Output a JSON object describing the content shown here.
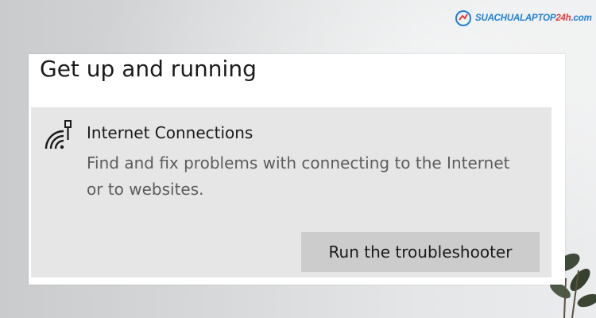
{
  "watermark": {
    "brand_main": "SUACHUALAPTOP",
    "brand_accent": "24h",
    "brand_suffix": ".com",
    "color_main": "#1e7fd6",
    "color_accent": "#e23b3b"
  },
  "panel": {
    "title": "Get up and running"
  },
  "troubleshooter": {
    "icon": "wifi-network-icon",
    "title": "Internet Connections",
    "description": "Find and fix problems with connecting to the Internet or to websites.",
    "run_button_label": "Run the troubleshooter"
  },
  "colors": {
    "card_background": "#e6e6e6",
    "button_background": "#cccccc",
    "description_text": "#5c5c5c"
  }
}
